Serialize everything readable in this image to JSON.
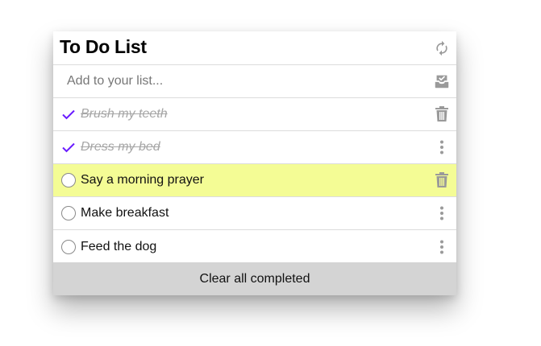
{
  "app": {
    "title": "To Do List"
  },
  "add": {
    "placeholder": "Add to your list..."
  },
  "items": [
    {
      "label": "Brush my teeth",
      "completed": true,
      "action_icon": "trash-icon"
    },
    {
      "label": "Dress my bed",
      "completed": true,
      "action_icon": "more-vert-icon"
    },
    {
      "label": "Say a morning prayer",
      "completed": false,
      "action_icon": "trash-icon",
      "highlighted": true
    },
    {
      "label": "Make breakfast",
      "completed": false,
      "action_icon": "more-vert-icon"
    },
    {
      "label": "Feed the dog",
      "completed": false,
      "action_icon": "more-vert-icon"
    }
  ],
  "footer": {
    "clear_label": "Clear all completed"
  },
  "colors": {
    "check": "#6a1bff",
    "highlight": "#f4fc95",
    "icon": "#9a9a9a",
    "footer_bg": "#d4d4d4"
  }
}
